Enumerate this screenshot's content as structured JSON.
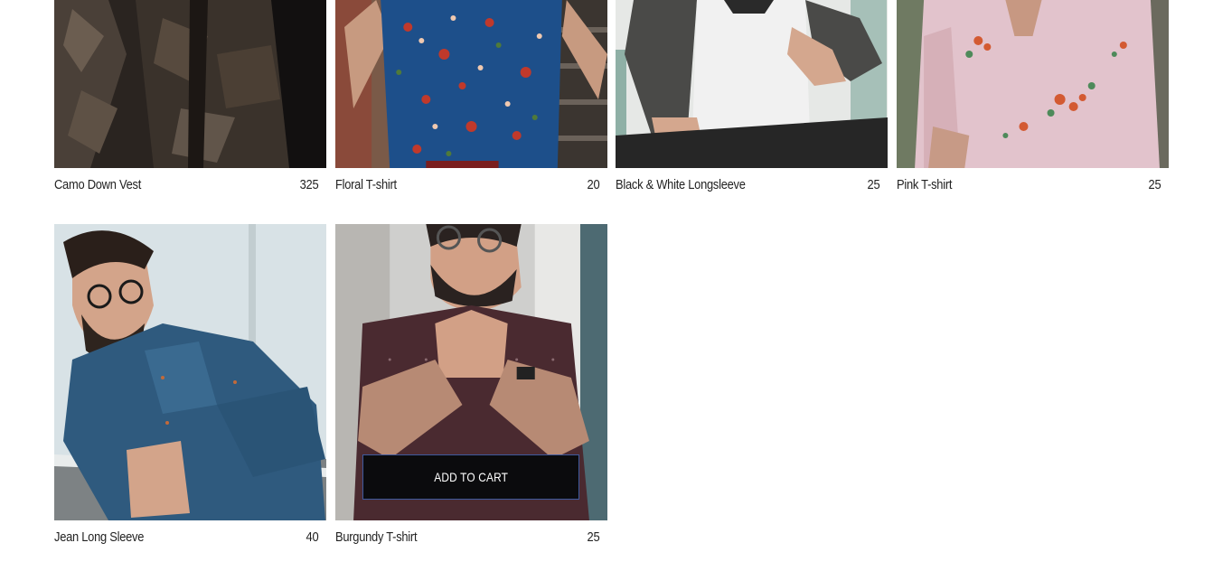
{
  "products": [
    {
      "name": "Camo Down Vest",
      "price": "325"
    },
    {
      "name": "Floral T-shirt",
      "price": "20"
    },
    {
      "name": "Black & White Longsleeve",
      "price": "25"
    },
    {
      "name": "Pink T-shirt",
      "price": "25"
    },
    {
      "name": "Jean Long Sleeve",
      "price": "40"
    },
    {
      "name": "Burgundy T-shirt",
      "price": "25"
    }
  ],
  "add_to_cart_label": "ADD TO CART",
  "colors": {
    "button_bg": "#0b0b0d",
    "button_border": "#3f5a9e",
    "text": "#222222"
  }
}
